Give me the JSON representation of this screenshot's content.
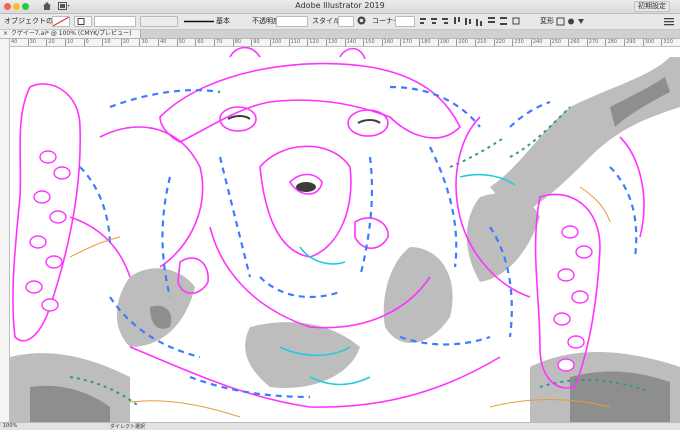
{
  "window": {
    "title": "Adobe Illustrator 2019",
    "workspace_label": "初期設定",
    "traffic_lights": [
      "#fc5f57",
      "#fdbc2e",
      "#28c840"
    ]
  },
  "control_bar": {
    "selection_label": "オブジェクトの選択",
    "stroke_label": "基本",
    "opacity_label": "不透明度",
    "style_label": "スタイル",
    "corner_label": "コーナー",
    "transform_label": "変形"
  },
  "document_tab": {
    "label": "クゲイー7.ai* @ 100% (CMYK/プレビュー)"
  },
  "ruler": {
    "ticks": [
      "40",
      "30",
      "20",
      "10",
      "0",
      "10",
      "20",
      "30",
      "40",
      "50",
      "60",
      "70",
      "80",
      "90",
      "100",
      "110",
      "120",
      "130",
      "140",
      "150",
      "160",
      "170",
      "180",
      "190",
      "200",
      "210",
      "220",
      "230",
      "240",
      "250",
      "260",
      "270",
      "280",
      "290",
      "300",
      "310"
    ]
  },
  "artwork": {
    "description_colors": {
      "outline": "#ff33ff",
      "path_blue": "#3c7dff",
      "cyan": "#22ccdd",
      "gray_fill": "#b9b9b9",
      "dark_gray": "#8e8e8e",
      "teal": "#2f9a8c",
      "orange": "#e89a3c"
    }
  },
  "status_bar": {
    "zoom": "100%",
    "tool": "ダイレクト選択"
  }
}
